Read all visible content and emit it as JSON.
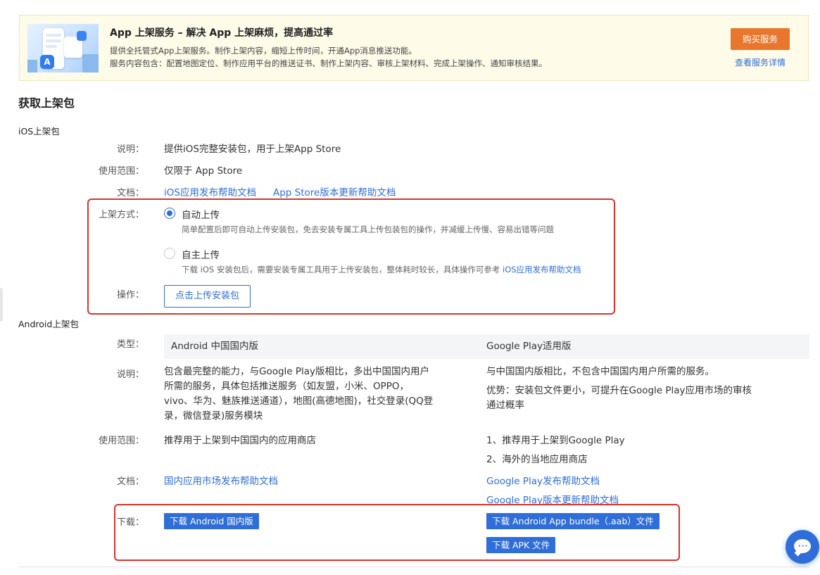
{
  "banner": {
    "title": "App 上架服务 – 解决 App 上架麻烦，提高通过率",
    "desc_line1": "提供全托管式App上架服务。制作上架内容，缩短上传时间，开通App消息推送功能。",
    "desc_line2": "服务内容包含：配置地图定位、制作应用平台的推送证书、制作上架内容、审核上架材料、完成上架操作、通知审核结果。",
    "buy_label": "购买服务",
    "detail_label": "查看服务详情"
  },
  "section_title": "获取上架包",
  "ios": {
    "title": "iOS上架包",
    "desc_label": "说明：",
    "desc_value": "提供iOS完整安装包，用于上架App Store",
    "scope_label": "使用范围：",
    "scope_value": "仅限于 App Store",
    "docs_label": "文档：",
    "doc_link1": "iOS应用发布帮助文档",
    "doc_link2": "App Store版本更新帮助文档",
    "method_label": "上架方式：",
    "option_auto": "自动上传",
    "option_auto_hint": "简单配置后即可自动上传安装包，免去安装专属工具上传包装包的操作，并减缓上传慢、容易出错等问题",
    "option_manual": "自主上传",
    "option_manual_hint": "下载 iOS 安装包后，需要安装专属工具用于上传安装包，整体耗时较长，具体操作可参考 ",
    "option_manual_hint_link": "iOS应用发布帮助文档",
    "action_label": "操作：",
    "upload_label": "点击上传安装包"
  },
  "android": {
    "title": "Android上架包",
    "type_label": "类型：",
    "col_cn": "Android 中国国内版",
    "col_gp": "Google Play适用版",
    "desc_label": "说明：",
    "cn_desc": [
      "包含最完整的能力，与Google Play版相比，多出中国国内用户",
      "所需的服务，具体包括推送服务（如友盟，小米、OPPO，",
      "vivo、华为、魅族推送通道），地图(高德地图)，社交登录(QQ登",
      "录，微信登录)服务模块"
    ],
    "gp_desc1": "与中国国内版相比，不包含中国国内用户所需的服务。",
    "gp_desc2": [
      "优势：安装包文件更小，可提升在Google Play应用市场的审核",
      "通过概率"
    ],
    "scope_label": "使用范围：",
    "cn_scope": "推荐用于上架到中国国内的应用商店",
    "gp_scope1": "1、推荐用于上架到Google Play",
    "gp_scope2": "2、海外的当地应用商店",
    "docs_label": "文档：",
    "cn_doc": "国内应用市场发布帮助文档",
    "gp_doc1": "Google Play发布帮助文档",
    "gp_doc2": "Google Play版本更新帮助文档",
    "download_label": "下载：",
    "dl_cn": "下载 Android 国内版",
    "dl_aab": "下载 Android App bundle（.aab）文件",
    "dl_apk": "下载 APK 文件"
  },
  "colors": {
    "accent": "#2f6ed8",
    "buy_button": "#e8772d",
    "highlight_box": "#d9342b",
    "banner_bg": "#fffbe9"
  },
  "icons": [
    "app-store-icon",
    "chat-icon"
  ]
}
